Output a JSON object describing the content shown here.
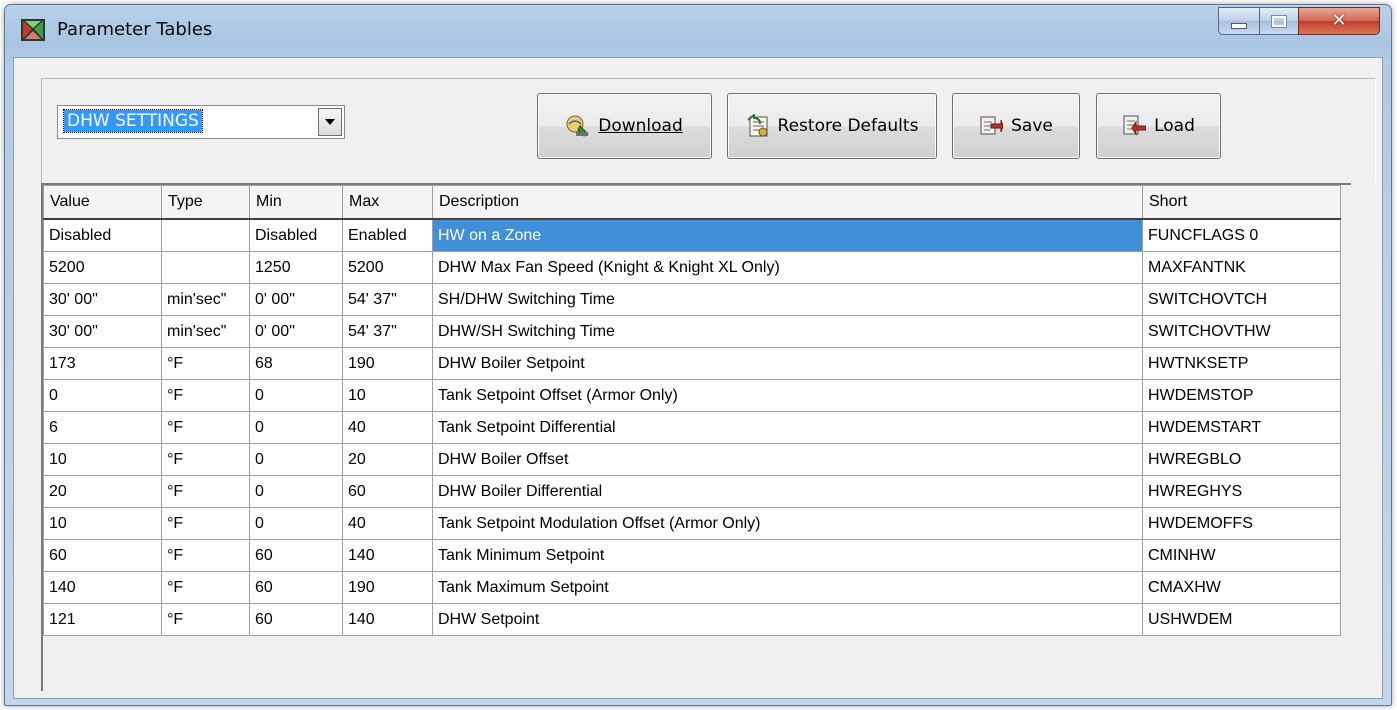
{
  "window": {
    "title": "Parameter Tables",
    "close_glyph": "✕"
  },
  "toolbar": {
    "table_select_value": "DHW SETTINGS",
    "download_label": "Download",
    "restore_defaults_label": "Restore Defaults",
    "save_label": "Save",
    "load_label": "Load"
  },
  "grid": {
    "columns": [
      "Value",
      "Type",
      "Min",
      "Max",
      "Description",
      "Short"
    ],
    "selected_row": 0,
    "rows": [
      [
        "Disabled",
        "",
        "Disabled",
        "Enabled",
        "HW on a Zone",
        "FUNCFLAGS 0"
      ],
      [
        "5200",
        "",
        "1250",
        "5200",
        "DHW Max Fan Speed (Knight & Knight XL Only)",
        "MAXFANTNK"
      ],
      [
        "30' 00\"",
        "min'sec\"",
        "0' 00\"",
        "54' 37\"",
        "SH/DHW Switching Time",
        "SWITCHOVTCH"
      ],
      [
        "30' 00\"",
        "min'sec\"",
        "0' 00\"",
        "54' 37\"",
        "DHW/SH Switching Time",
        "SWITCHOVTHW"
      ],
      [
        "173",
        "°F",
        "68",
        "190",
        "DHW Boiler Setpoint",
        "HWTNKSETP"
      ],
      [
        "0",
        "°F",
        "0",
        "10",
        "Tank Setpoint Offset (Armor Only)",
        "HWDEMSTOP"
      ],
      [
        "6",
        "°F",
        "0",
        "40",
        "Tank Setpoint Differential",
        "HWDEMSTART"
      ],
      [
        "10",
        "°F",
        "0",
        "20",
        "DHW Boiler Offset",
        "HWREGBLO"
      ],
      [
        "20",
        "°F",
        "0",
        "60",
        "DHW Boiler Differential",
        "HWREGHYS"
      ],
      [
        "10",
        "°F",
        "0",
        "40",
        "Tank Setpoint Modulation Offset (Armor Only)",
        "HWDEMOFFS"
      ],
      [
        "60",
        "°F",
        "60",
        "140",
        "Tank Minimum Setpoint",
        "CMINHW"
      ],
      [
        "140",
        "°F",
        "60",
        "190",
        "Tank Maximum Setpoint",
        "CMAXHW"
      ],
      [
        "121",
        "°F",
        "60",
        "140",
        "DHW Setpoint",
        "USHWDEM"
      ]
    ]
  },
  "icons": {
    "app": "parameter-tables-app-icon",
    "download": "download-icon",
    "restore": "restore-defaults-icon",
    "save": "save-icon",
    "load": "load-icon"
  },
  "colors": {
    "selection": "#3f8fd9",
    "combo_highlight": "#3399ff",
    "close_button": "#c2402a"
  }
}
